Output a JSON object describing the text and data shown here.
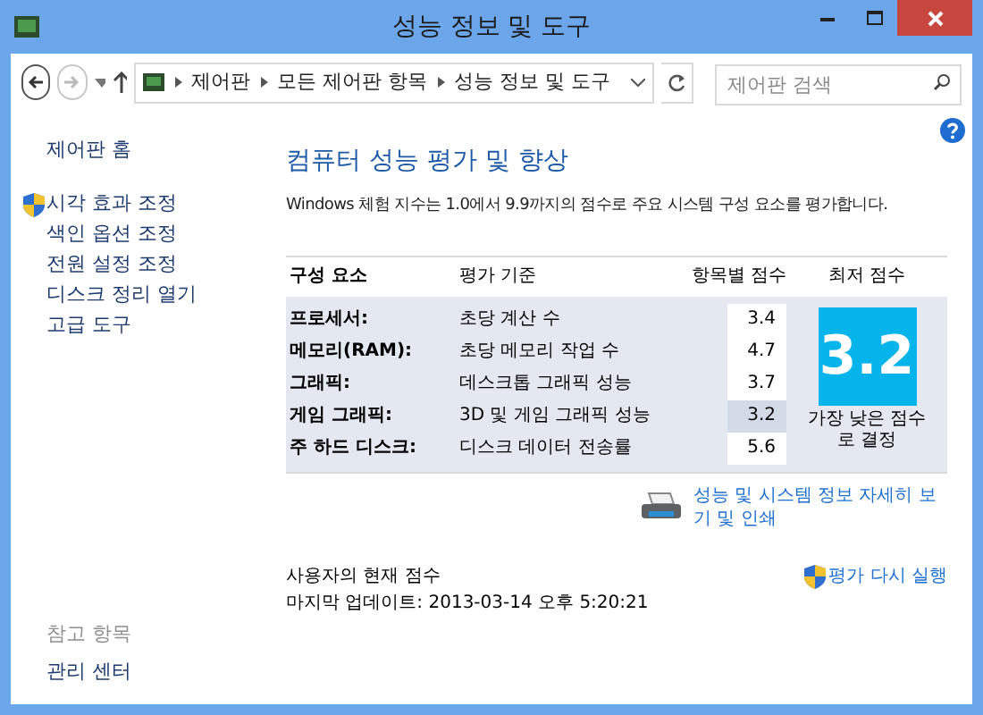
{
  "window": {
    "title": "성능 정보 및 도구"
  },
  "address_bar": {
    "crumbs": [
      "제어판",
      "모든 제어판 항목",
      "성능 정보 및 도구"
    ]
  },
  "search": {
    "placeholder": "제어판 검색"
  },
  "sidebar": {
    "home": "제어판 홈",
    "items": [
      {
        "label": "시각 효과 조정",
        "kind": "shield"
      },
      {
        "label": "색인 옵션 조정",
        "kind": "plain"
      },
      {
        "label": "전원 설정 조정",
        "kind": "plain"
      },
      {
        "label": "디스크 정리 열기",
        "kind": "plain"
      },
      {
        "label": "고급 도구",
        "kind": "plain"
      }
    ],
    "see_also_heading": "참고 항목",
    "see_also": [
      "관리 센터"
    ]
  },
  "heading": "컴퓨터 성능 평가 및 향상",
  "description": "Windows 체험 지수는 1.0에서 9.9까지의 점수로 주요 시스템 구성 요소를 평가합니다.",
  "table": {
    "columns": [
      "구성 요소",
      "평가 기준",
      "항목별 점수",
      "최저 점수"
    ],
    "rows": [
      {
        "component": "프로세서:",
        "criterion": "초당 계산 수",
        "score": "3.4",
        "highlighted": false
      },
      {
        "component": "메모리(RAM):",
        "criterion": "초당 메모리 작업 수",
        "score": "4.7",
        "highlighted": false
      },
      {
        "component": "그래픽:",
        "criterion": "데스크톱 그래픽 성능",
        "score": "3.7",
        "highlighted": false
      },
      {
        "component": "게임 그래픽:",
        "criterion": "3D 및 게임 그래픽 성능",
        "score": "3.2",
        "highlighted": true
      },
      {
        "component": "주 하드 디스크:",
        "criterion": "디스크 데이터 전송률",
        "score": "5.6",
        "highlighted": false
      }
    ],
    "base_score": "3.2",
    "base_caption": "가장 낮은 점수로 결정"
  },
  "print_link": "성능 및 시스템 정보 자세히 보기 및 인쇄",
  "status": {
    "label": "사용자의 현재 점수",
    "updated": "마지막 업데이트: 2013-03-14 오후 5:20:21",
    "rerun": "평가 다시 실행"
  }
}
